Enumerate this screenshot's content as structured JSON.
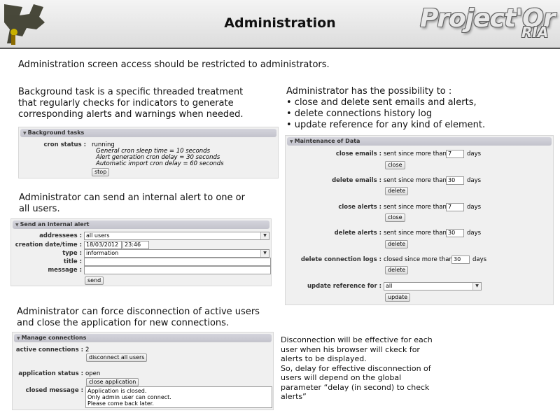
{
  "header": {
    "title": "Administration",
    "brand": "Project'Or",
    "brand_sub": "RIA"
  },
  "intro": "Administration screen access should be restricted to administrators.",
  "bg_text": [
    "Background task is a specific threaded treatment",
    "that regularly checks for indicators to generate",
    "corresponding alerts and warnings when needed."
  ],
  "maint_text": {
    "line1": "Administrator has the possibility to :",
    "bullets": [
      "• close and delete sent emails and alerts,",
      "• delete connections history log",
      "• update reference for any kind of element."
    ]
  },
  "alert_text": [
    "Administrator can send an internal alert to one or",
    "all users."
  ],
  "disc_text": [
    "Administrator can force disconnection of active users",
    "and close the application for new connections."
  ],
  "note_text": [
    "Disconnection will be effective for each",
    "user when his browser will ckeck for",
    "alerts to be displayed.",
    "So, delay for effective disconnection of",
    "users will depend on the global",
    "parameter “delay (in second) to check",
    "alerts”"
  ],
  "background_tasks": {
    "title": "Background tasks",
    "cron_label": "cron status :",
    "status": "running",
    "sleep": "General cron sleep time = 10 seconds",
    "alert_delay": "Alert generation cron delay = 30 seconds",
    "import_delay": "Automatic import cron delay = 60 seconds",
    "stop": "stop"
  },
  "internal_alert": {
    "title": "Send an internal alert",
    "addressees_label": "addressees :",
    "addressees_value": "all users",
    "date_label": "creation date/time :",
    "date": "18/03/2012",
    "time": "23:46",
    "type_label": "type :",
    "type_value": "information",
    "title_label": "title :",
    "message_label": "message :",
    "send": "send"
  },
  "manage_connections": {
    "title": "Manage connections",
    "active_label": "active connections :",
    "active_count": "2",
    "disconnect_all": "disconnect all users",
    "status_label": "application status :",
    "status_value": "open",
    "close_app": "close application",
    "closed_msg_label": "closed message :",
    "closed_msg": [
      "Application is closed.",
      "Only admin user can connect.",
      "Please come back later."
    ]
  },
  "maintenance": {
    "title": "Maintenance of Data",
    "close_emails_label": "close emails :",
    "close_emails_pre": "sent since more than",
    "close_emails_val": "7",
    "delete_emails_label": "delete emails :",
    "delete_emails_pre": "sent since more than",
    "delete_emails_val": "30",
    "close_alerts_label": "close alerts :",
    "close_alerts_pre": "sent since more than",
    "close_alerts_val": "7",
    "delete_alerts_label": "delete alerts :",
    "delete_alerts_pre": "sent since more than",
    "delete_alerts_val": "30",
    "delete_logs_label": "delete connection logs :",
    "delete_logs_pre": "closed since more than",
    "delete_logs_val": "30",
    "days": "days",
    "update_ref_label": "update reference for :",
    "update_ref_value": "all",
    "close": "close",
    "delete": "delete",
    "update": "update"
  }
}
